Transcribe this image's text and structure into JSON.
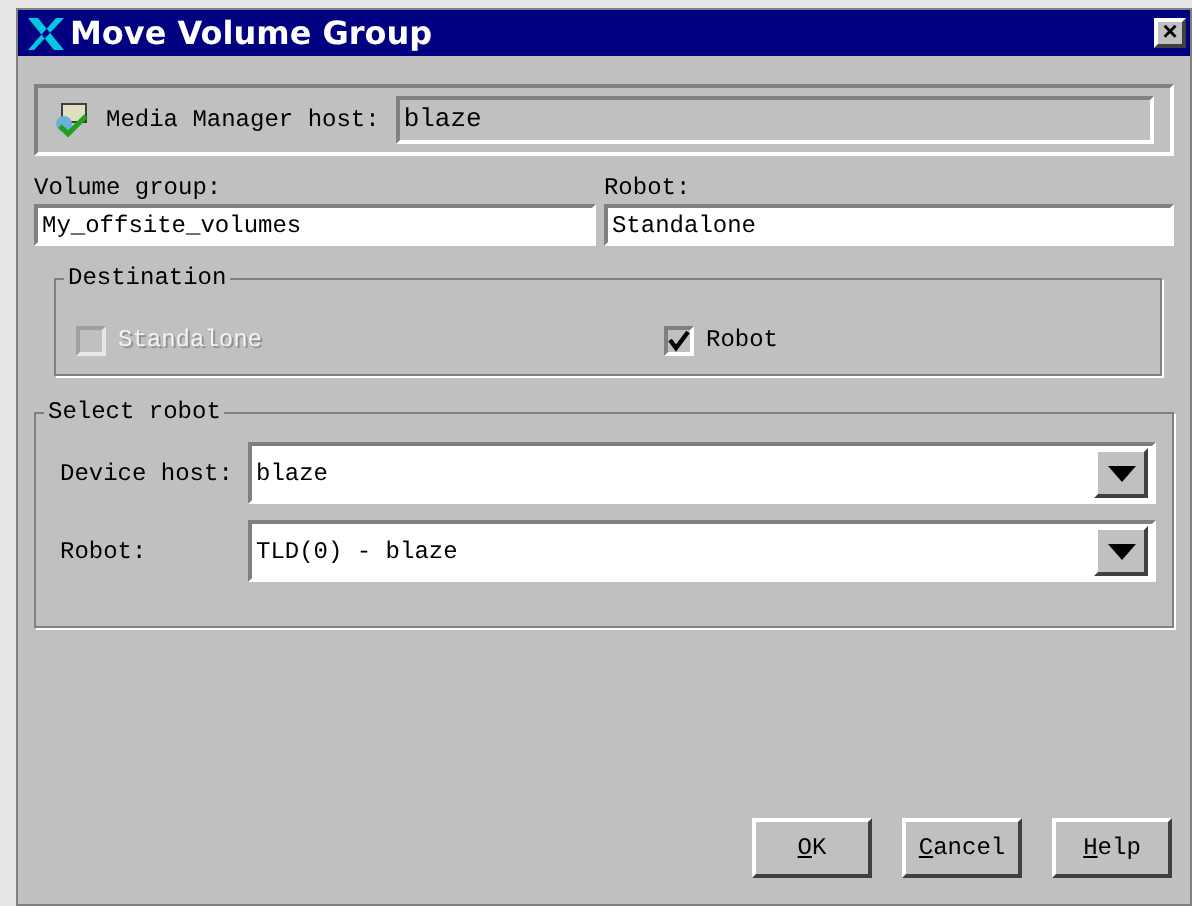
{
  "window": {
    "title": "Move Volume Group",
    "close": "×"
  },
  "host": {
    "label": "Media Manager host:",
    "value": "blaze"
  },
  "volume_group": {
    "label": "Volume group:",
    "value": "My_offsite_volumes"
  },
  "robot": {
    "label": "Robot:",
    "value": "Standalone"
  },
  "destination": {
    "title": "Destination",
    "options": [
      {
        "label": "Standalone",
        "checked": false,
        "disabled": true
      },
      {
        "label": "Robot",
        "checked": true,
        "disabled": false
      }
    ]
  },
  "select_robot": {
    "title": "Select robot",
    "fields": [
      {
        "label": "Device host:",
        "value": "blaze"
      },
      {
        "label": "Robot:",
        "value": "TLD(0) - blaze"
      }
    ]
  },
  "buttons": [
    {
      "mnemonic": "O",
      "rest": "K"
    },
    {
      "mnemonic": "C",
      "rest": "ancel"
    },
    {
      "mnemonic": "H",
      "rest": "elp"
    }
  ]
}
